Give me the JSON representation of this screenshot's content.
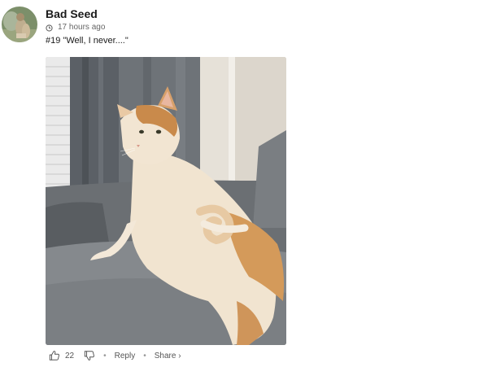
{
  "comment": {
    "username": "Bad Seed",
    "time": "17 hours ago",
    "text": "#19 \"Well, I never....\"",
    "avatar_icon": "squirrel-avatar",
    "media_description_icon": "cat-photo"
  },
  "actions": {
    "like_count": "22",
    "reply_label": "Reply",
    "share_label": "Share",
    "share_chevron": "›",
    "separator": "•"
  }
}
